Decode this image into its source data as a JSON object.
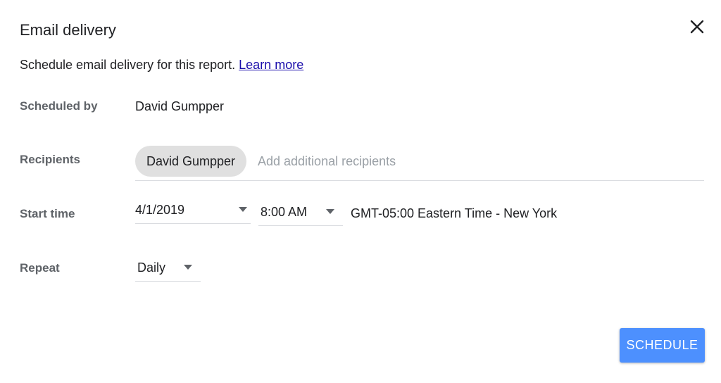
{
  "dialog": {
    "title": "Email delivery",
    "description": "Schedule email delivery for this report.",
    "learn_more": "Learn more",
    "close_icon": "close-icon"
  },
  "scheduled_by": {
    "label": "Scheduled by",
    "value": "David Gumpper"
  },
  "recipients": {
    "label": "Recipients",
    "chips": [
      "David Gumpper"
    ],
    "placeholder": "Add additional recipients"
  },
  "start_time": {
    "label": "Start time",
    "date": "4/1/2019",
    "time": "8:00 AM",
    "timezone": "GMT-05:00 Eastern Time - New York"
  },
  "repeat": {
    "label": "Repeat",
    "value": "Daily"
  },
  "actions": {
    "schedule": "SCHEDULE"
  },
  "colors": {
    "primary_button": "#4d90fe",
    "link": "#1a0dab",
    "chip_bg": "#e0e0e0",
    "label": "#5f6368"
  }
}
